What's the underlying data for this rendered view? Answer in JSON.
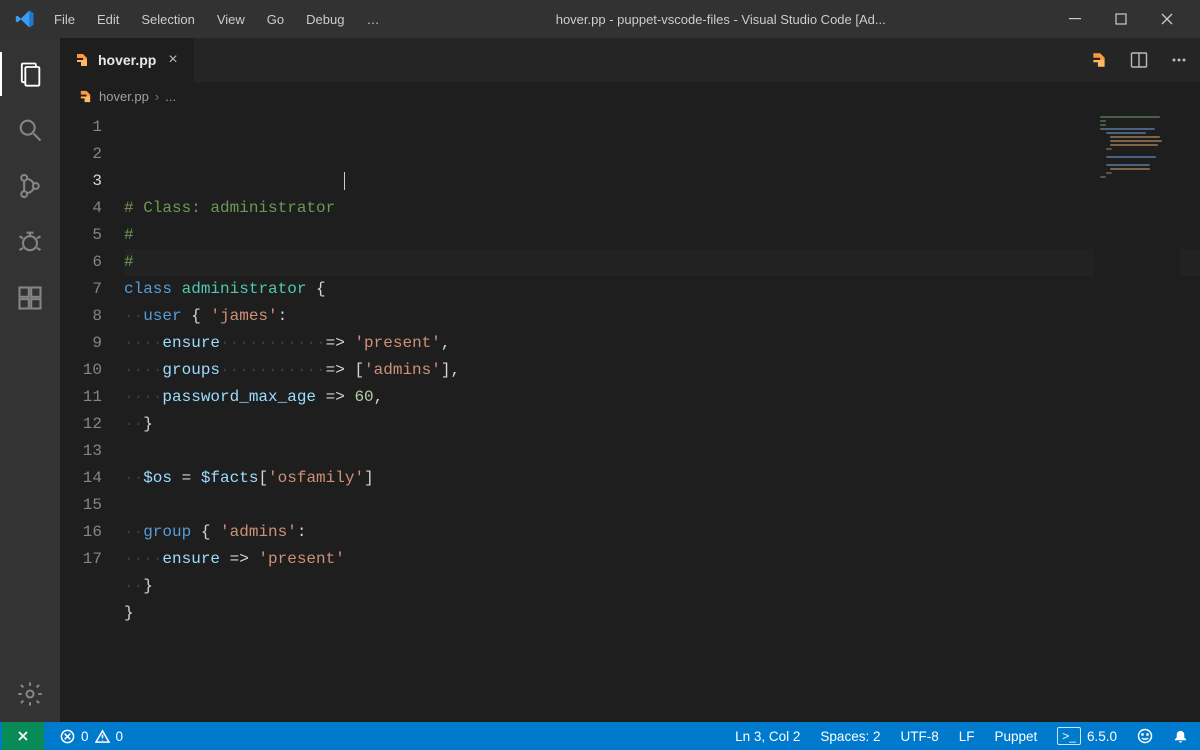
{
  "titlebar": {
    "menus": [
      "File",
      "Edit",
      "Selection",
      "View",
      "Go",
      "Debug",
      "…"
    ],
    "title": "hover.pp - puppet-vscode-files - Visual Studio Code [Ad..."
  },
  "activitybar": {
    "items": [
      "explorer",
      "search",
      "source-control",
      "debug",
      "extensions"
    ],
    "bottom": [
      "settings"
    ]
  },
  "tabs": {
    "open": [
      {
        "name": "hover.pp",
        "icon": "puppet"
      }
    ]
  },
  "breadcrumb": {
    "file": "hover.pp",
    "suffix": "..."
  },
  "editor": {
    "cursor_line": 3,
    "lines": [
      [
        {
          "c": "comment",
          "t": "# Class: administrator"
        }
      ],
      [
        {
          "c": "comment",
          "t": "#"
        }
      ],
      [
        {
          "c": "comment",
          "t": "#"
        }
      ],
      [
        {
          "c": "keyword",
          "t": "class"
        },
        {
          "c": "punc",
          "t": " "
        },
        {
          "c": "name",
          "t": "administrator"
        },
        {
          "c": "punc",
          "t": " {"
        }
      ],
      [
        {
          "c": "ws",
          "t": "··"
        },
        {
          "c": "keyword",
          "t": "user"
        },
        {
          "c": "punc",
          "t": " { "
        },
        {
          "c": "str",
          "t": "'james'"
        },
        {
          "c": "punc",
          "t": ":"
        }
      ],
      [
        {
          "c": "ws",
          "t": "····"
        },
        {
          "c": "attr",
          "t": "ensure"
        },
        {
          "c": "ws",
          "t": "···········"
        },
        {
          "c": "punc",
          "t": "=> "
        },
        {
          "c": "str",
          "t": "'present'"
        },
        {
          "c": "punc",
          "t": ","
        }
      ],
      [
        {
          "c": "ws",
          "t": "····"
        },
        {
          "c": "attr",
          "t": "groups"
        },
        {
          "c": "ws",
          "t": "···········"
        },
        {
          "c": "punc",
          "t": "=> ["
        },
        {
          "c": "str",
          "t": "'admins'"
        },
        {
          "c": "punc",
          "t": "],"
        }
      ],
      [
        {
          "c": "ws",
          "t": "····"
        },
        {
          "c": "attr",
          "t": "password_max_age"
        },
        {
          "c": "punc",
          "t": " => "
        },
        {
          "c": "num",
          "t": "60"
        },
        {
          "c": "punc",
          "t": ","
        }
      ],
      [
        {
          "c": "ws",
          "t": "··"
        },
        {
          "c": "punc",
          "t": "}"
        }
      ],
      [],
      [
        {
          "c": "ws",
          "t": "··"
        },
        {
          "c": "var",
          "t": "$os"
        },
        {
          "c": "punc",
          "t": " = "
        },
        {
          "c": "var",
          "t": "$facts"
        },
        {
          "c": "punc",
          "t": "["
        },
        {
          "c": "str",
          "t": "'osfamily'"
        },
        {
          "c": "punc",
          "t": "]"
        }
      ],
      [],
      [
        {
          "c": "ws",
          "t": "··"
        },
        {
          "c": "keyword",
          "t": "group"
        },
        {
          "c": "punc",
          "t": " { "
        },
        {
          "c": "str",
          "t": "'admins'"
        },
        {
          "c": "punc",
          "t": ":"
        }
      ],
      [
        {
          "c": "ws",
          "t": "····"
        },
        {
          "c": "attr",
          "t": "ensure"
        },
        {
          "c": "punc",
          "t": " => "
        },
        {
          "c": "str",
          "t": "'present'"
        }
      ],
      [
        {
          "c": "ws",
          "t": "··"
        },
        {
          "c": "punc",
          "t": "}"
        }
      ],
      [
        {
          "c": "punc",
          "t": "}"
        }
      ],
      []
    ]
  },
  "statusbar": {
    "errors": "0",
    "warnings": "0",
    "cursor": "Ln 3, Col 2",
    "spaces": "Spaces: 2",
    "encoding": "UTF-8",
    "eol": "LF",
    "language": "Puppet",
    "version": "6.5.0"
  }
}
